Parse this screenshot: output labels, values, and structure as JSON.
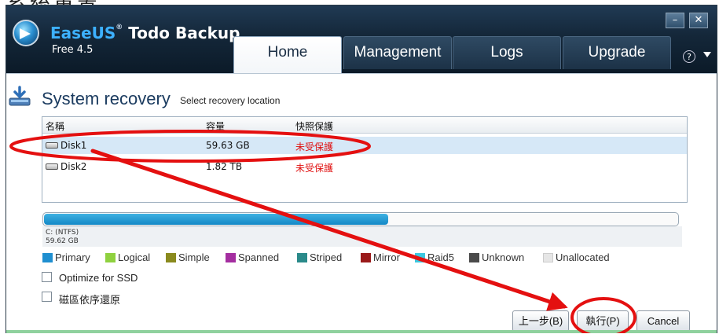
{
  "top_caption": "系統重置",
  "app": {
    "brand": "EaseUS",
    "name_rest": " Todo Backup",
    "reg_mark": "®",
    "version": "Free 4.5"
  },
  "tabs": [
    {
      "label": "Home",
      "active": true
    },
    {
      "label": "Management",
      "active": false
    },
    {
      "label": "Logs",
      "active": false
    },
    {
      "label": "Upgrade",
      "active": false
    }
  ],
  "window_controls": {
    "minimize": "–",
    "close": "✕",
    "help": "?"
  },
  "page": {
    "title": "System recovery",
    "subtitle": "Select recovery location"
  },
  "disk_table": {
    "headers": [
      "名稱",
      "容量",
      "快照保護"
    ],
    "rows": [
      {
        "name": "Disk1",
        "capacity": "59.63 GB",
        "snapshot": "未受保護",
        "selected": true
      },
      {
        "name": "Disk2",
        "capacity": "1.82 TB",
        "snapshot": "未受保護",
        "selected": false
      }
    ]
  },
  "partition": {
    "name": "C: (NTFS)",
    "size": "59.62 GB",
    "used_fraction": 0.544
  },
  "legend": [
    {
      "label": "Primary",
      "color": "#1f8fd0"
    },
    {
      "label": "Logical",
      "color": "#8fd13f"
    },
    {
      "label": "Simple",
      "color": "#8a8a1e"
    },
    {
      "label": "Spanned",
      "color": "#a42ea0"
    },
    {
      "label": "Striped",
      "color": "#2a8a8a"
    },
    {
      "label": "Mirror",
      "color": "#9a1a1a"
    },
    {
      "label": "Raid5",
      "color": "#3cc8e0"
    },
    {
      "label": "Unknown",
      "color": "#4a4a4a"
    },
    {
      "label": "Unallocated",
      "color": "#e6e6e6"
    }
  ],
  "options": {
    "optimize_ssd": {
      "label": "Optimize for SSD",
      "checked": false
    },
    "sector_restore": {
      "label": "磁區依序還原",
      "checked": false
    }
  },
  "buttons": {
    "back": "上一步(B)",
    "execute": "執行(P)",
    "cancel": "Cancel"
  },
  "annotation_color": "#e41010"
}
